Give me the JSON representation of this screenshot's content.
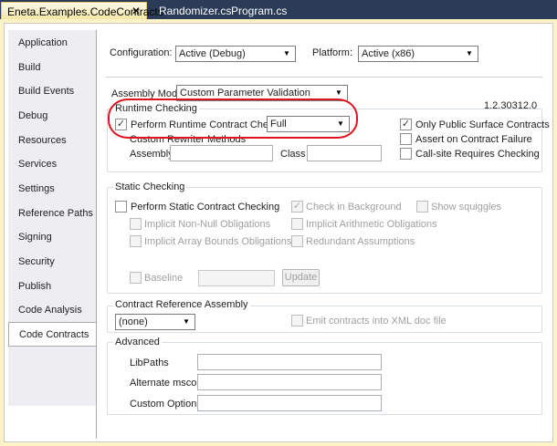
{
  "tabs": [
    {
      "label": "Eneta.Examples.CodeContracts",
      "close": "✕"
    },
    {
      "label": "Randomizer.cs"
    },
    {
      "label": "Program.cs"
    }
  ],
  "nav": [
    "Application",
    "Build",
    "Build Events",
    "Debug",
    "Resources",
    "Services",
    "Settings",
    "Reference Paths",
    "Signing",
    "Security",
    "Publish",
    "Code Analysis",
    "Code Contracts"
  ],
  "config": {
    "label": "Configuration:",
    "value": "Active (Debug)",
    "platform_label": "Platform:",
    "platform_value": "Active (x86)"
  },
  "assembly_mode": {
    "label": "Assembly Mode:",
    "value": "Custom Parameter Validation",
    "version": "1.2.30312.0"
  },
  "runtime": {
    "title": "Runtime Checking",
    "perform": "Perform Runtime Contract Checking",
    "level": "Full",
    "rewriter": "Custom Rewriter Methods",
    "assembly": "Assembly",
    "class": "Class",
    "public_surface": "Only Public Surface Contracts",
    "assert": "Assert on Contract Failure",
    "callsite": "Call-site Requires Checking",
    "check": "✓"
  },
  "static": {
    "title": "Static Checking",
    "perform": "Perform Static Contract Checking",
    "background": "Check in Background",
    "squiggles": "Show squiggles",
    "nonnull": "Implicit Non-Null Obligations",
    "arith": "Implicit Arithmetic Obligations",
    "bounds": "Implicit Array Bounds Obligations",
    "redundant": "Redundant Assumptions",
    "baseline": "Baseline",
    "update": "Update"
  },
  "reference": {
    "title": "Contract Reference Assembly",
    "value": "(none)",
    "emit": "Emit contracts into XML doc file"
  },
  "advanced": {
    "title": "Advanced",
    "libpaths": "LibPaths",
    "mscorlib": "Alternate mscorlib",
    "options": "Custom Options"
  },
  "icons": {
    "dropdown": "▼"
  }
}
